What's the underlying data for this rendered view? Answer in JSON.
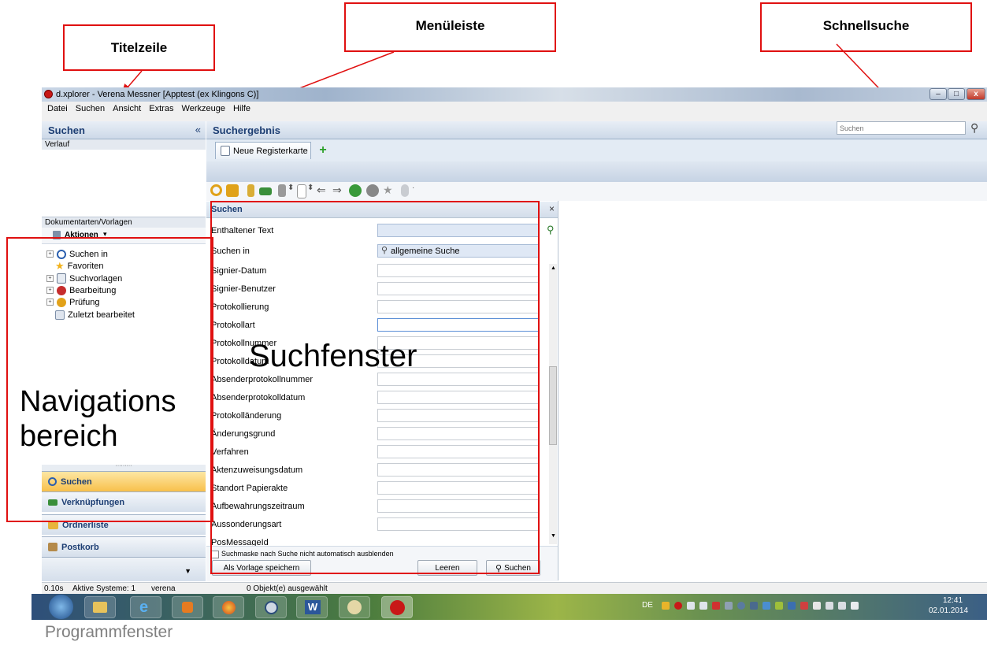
{
  "annotations": {
    "titelzeile": "Titelzeile",
    "menueleiste": "Menüleiste",
    "schnellsuche": "Schnellsuche",
    "suchfenster": "Suchfenster",
    "navigationsbereich_line1": "Navigations",
    "navigationsbereich_line2": "bereich",
    "programmfenster": "Programmfenster"
  },
  "window": {
    "title": "d.xplorer - Verena Messner [Apptest (ex Klingons C)]"
  },
  "menu": [
    "Datei",
    "Suchen",
    "Ansicht",
    "Extras",
    "Werkzeuge",
    "Hilfe"
  ],
  "left_panel": {
    "title": "Suchen",
    "collapse": "«",
    "verlauf": "Verlauf",
    "doc_types": "Dokumentarten/Vorlagen",
    "aktionen": "Aktionen",
    "tree": [
      {
        "label": "Suchen in",
        "expandable": true,
        "icon": "search-icon",
        "color": "#2b5fae"
      },
      {
        "label": "Favoriten",
        "expandable": false,
        "icon": "star-icon",
        "color": "#f2b21b"
      },
      {
        "label": "Suchvorlagen",
        "expandable": true,
        "icon": "search-template-icon",
        "color": "#6f7f96"
      },
      {
        "label": "Bearbeitung",
        "expandable": true,
        "icon": "edit-icon",
        "color": "#c62d2d"
      },
      {
        "label": "Prüfung",
        "expandable": true,
        "icon": "check-icon",
        "color": "#e2a21a"
      },
      {
        "label": "Zuletzt bearbeitet",
        "expandable": false,
        "icon": "recent-icon",
        "color": "#7d8fa8"
      }
    ],
    "nav_buttons": [
      {
        "label": "Suchen",
        "icon": "search-icon",
        "active": true
      },
      {
        "label": "Verknüpfungen",
        "icon": "link-icon",
        "active": false
      },
      {
        "label": "Ordnerliste",
        "icon": "folder-icon",
        "active": false
      },
      {
        "label": "Postkorb",
        "icon": "inbox-icon",
        "active": false
      }
    ]
  },
  "main": {
    "title": "Suchergebnis",
    "quick_search_placeholder": "Suchen",
    "tab_label": "Neue Registerkarte"
  },
  "search_form": {
    "title": "Suchen",
    "close": "×",
    "fields": [
      {
        "label": "Enthaltener Text",
        "value": ""
      },
      {
        "label": "Suchen in",
        "value": "allgemeine Suche"
      },
      {
        "label": "Signier-Datum",
        "value": ""
      },
      {
        "label": "Signier-Benutzer",
        "value": ""
      },
      {
        "label": "Protokollierung",
        "value": ""
      },
      {
        "label": "Protokollart",
        "value": ""
      },
      {
        "label": "Protokollnummer",
        "value": ""
      },
      {
        "label": "Protokolldatum",
        "value": ""
      },
      {
        "label": "Absenderprotokollnummer",
        "value": ""
      },
      {
        "label": "Absenderprotokolldatum",
        "value": ""
      },
      {
        "label": "Protokolländerung",
        "value": ""
      },
      {
        "label": "Änderungsgrund",
        "value": ""
      },
      {
        "label": "Verfahren",
        "value": ""
      },
      {
        "label": "Aktenzuweisungsdatum",
        "value": ""
      },
      {
        "label": "Standort Papierakte",
        "value": ""
      },
      {
        "label": "Aufbewahrungszeitraum",
        "value": ""
      },
      {
        "label": "Aussonderungsart",
        "value": ""
      },
      {
        "label": "PosMessageId",
        "value": ""
      }
    ],
    "checkbox_label": "Suchmaske nach Suche nicht automatisch ausblenden",
    "btn_save_template": "Als Vorlage speichern",
    "btn_clear": "Leeren",
    "btn_search": "Suchen"
  },
  "status": {
    "time": "0.10s",
    "systems": "Aktive Systeme: 1",
    "user": "verena",
    "selection": "0 Objekt(e) ausgewählt"
  },
  "taskbar": {
    "lang": "DE",
    "time": "12:41",
    "date": "02.01.2014"
  },
  "colors": {
    "accent_red": "#e01010",
    "header_blue": "#1d3e73",
    "active_nav": "#f8c04b"
  }
}
